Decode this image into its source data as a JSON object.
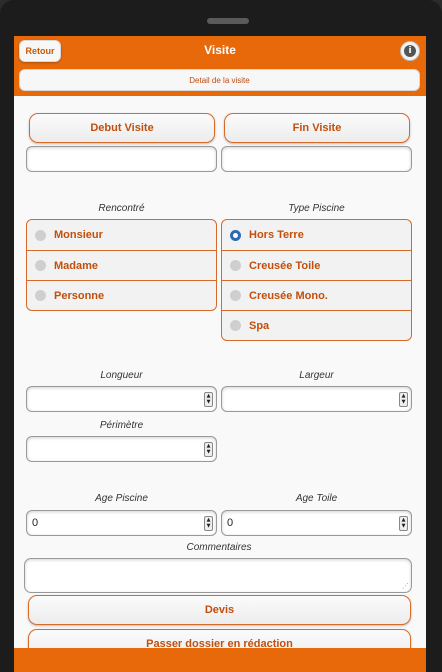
{
  "header": {
    "back_label": "Retour",
    "title": "Visite",
    "info_icon": "i",
    "subtitle": "Detail de la visite"
  },
  "visit": {
    "start_button": "Debut Visite",
    "end_button": "Fin Visite",
    "start_value": "",
    "end_value": ""
  },
  "rencontre": {
    "label": "Rencontré",
    "options": [
      "Monsieur",
      "Madame",
      "Personne"
    ],
    "selected": null
  },
  "piscine": {
    "label": "Type Piscine",
    "options": [
      "Hors Terre",
      "Creusée Toile",
      "Creusée Mono.",
      "Spa"
    ],
    "selected": "Hors Terre"
  },
  "dimensions": {
    "longueur_label": "Longueur",
    "longueur_value": "",
    "largeur_label": "Largeur",
    "largeur_value": "",
    "perimetre_label": "Périmètre",
    "perimetre_value": ""
  },
  "ages": {
    "piscine_label": "Age Piscine",
    "piscine_value": "0",
    "toile_label": "Age Toile",
    "toile_value": "0"
  },
  "comments": {
    "label": "Commentaires",
    "value": ""
  },
  "actions": {
    "devis_label": "Devis",
    "redaction_label": "Passer dossier en rédaction"
  },
  "colors": {
    "accent": "#e7690a",
    "text_accent": "#c24f0c",
    "radio_checked": "#2a6db5"
  }
}
